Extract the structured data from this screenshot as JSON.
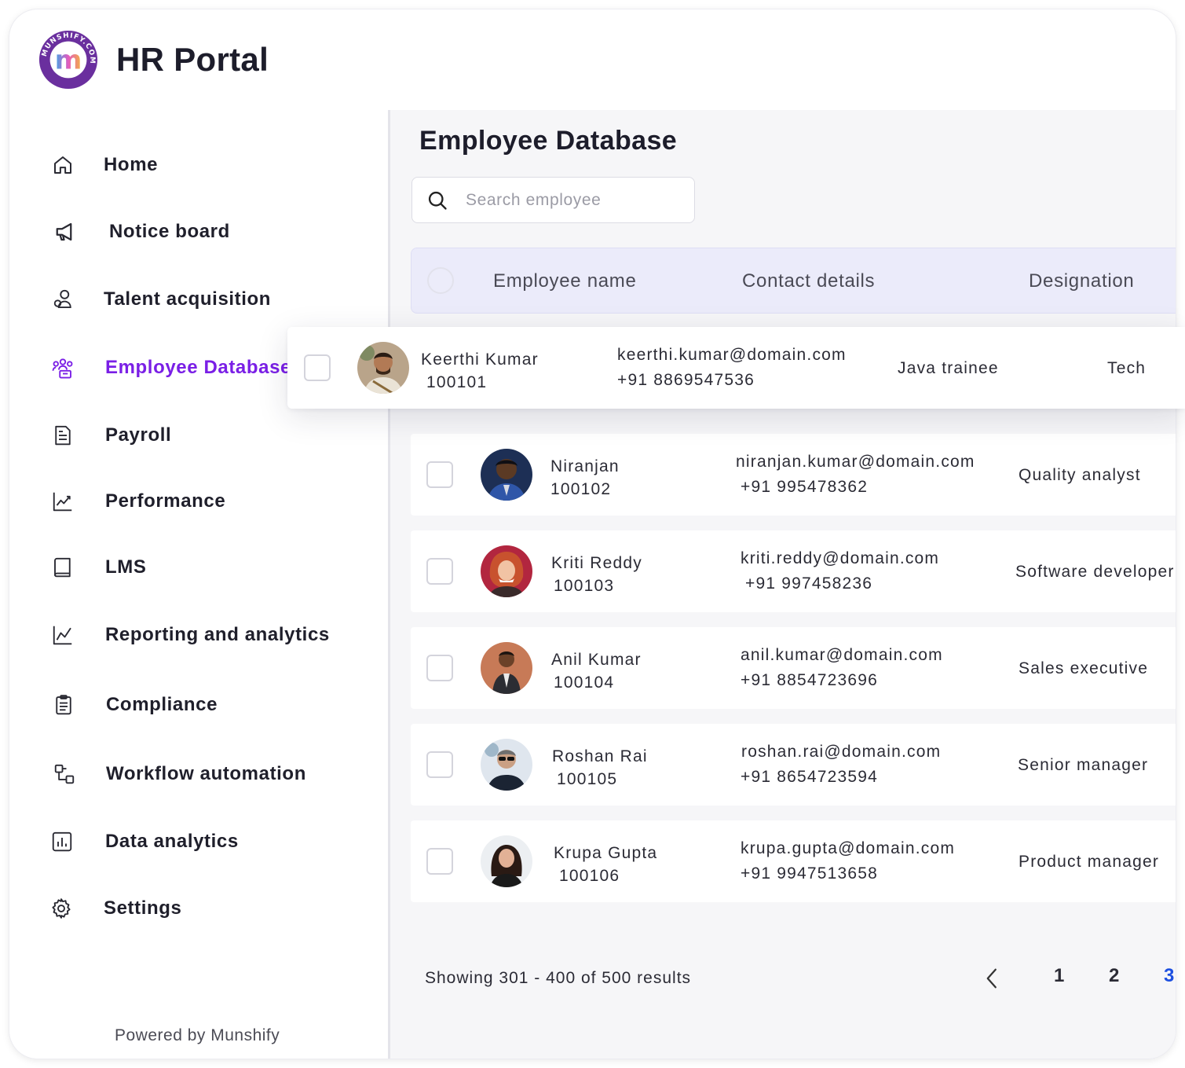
{
  "app": {
    "title": "HR Portal",
    "logo_ring_text": "MUNSHIFY.COM",
    "logo_letter": "m",
    "footer": "Powered by Munshify"
  },
  "sidebar": {
    "items": [
      {
        "label": "Home",
        "icon": "home-icon"
      },
      {
        "label": "Notice board",
        "icon": "megaphone-icon"
      },
      {
        "label": "Talent acquisition",
        "icon": "users-icon"
      },
      {
        "label": "Employee Database",
        "icon": "team-icon",
        "active": true
      },
      {
        "label": "Payroll",
        "icon": "document-icon"
      },
      {
        "label": "Performance",
        "icon": "trend-chart-icon"
      },
      {
        "label": "LMS",
        "icon": "book-icon"
      },
      {
        "label": "Reporting and analytics",
        "icon": "line-chart-icon"
      },
      {
        "label": "Compliance",
        "icon": "clipboard-icon"
      },
      {
        "label": "Workflow automation",
        "icon": "workflow-icon"
      },
      {
        "label": "Data analytics",
        "icon": "bar-chart-icon"
      },
      {
        "label": "Settings",
        "icon": "gear-icon"
      }
    ]
  },
  "main": {
    "title": "Employee Database",
    "search": {
      "placeholder": "Search employee",
      "value": ""
    },
    "table": {
      "columns": [
        "Employee name",
        "Contact details",
        "Designation"
      ],
      "highlighted": {
        "name": "Keerthi Kumar",
        "id": "100101",
        "email": "keerthi.kumar@domain.com",
        "phone": "+91 8869547536",
        "designation": "Java trainee",
        "department": "Tech"
      },
      "rows": [
        {
          "name": "Niranjan",
          "id": "100102",
          "email": "niranjan.kumar@domain.com",
          "phone": "+91 995478362",
          "designation": "Quality analyst"
        },
        {
          "name": "Kriti Reddy",
          "id": "100103",
          "email": "kriti.reddy@domain.com",
          "phone": "+91 997458236",
          "designation": "Software developer"
        },
        {
          "name": "Anil Kumar",
          "id": "100104",
          "email": "anil.kumar@domain.com",
          "phone": "+91 8854723696",
          "designation": "Sales executive"
        },
        {
          "name": "Roshan Rai",
          "id": "100105",
          "email": "roshan.rai@domain.com",
          "phone": "+91 8654723594",
          "designation": "Senior manager"
        },
        {
          "name": "Krupa Gupta",
          "id": "100106",
          "email": "krupa.gupta@domain.com",
          "phone": "+91 9947513658",
          "designation": "Product manager"
        }
      ]
    },
    "pagination": {
      "summary": "Showing 301 - 400 of 500 results",
      "pages": [
        "1",
        "2",
        "3"
      ],
      "current": "3"
    }
  },
  "colors": {
    "accent": "#7a1fe6",
    "current_page": "#1c4fe0",
    "table_header_bg": "#ebebfa"
  }
}
